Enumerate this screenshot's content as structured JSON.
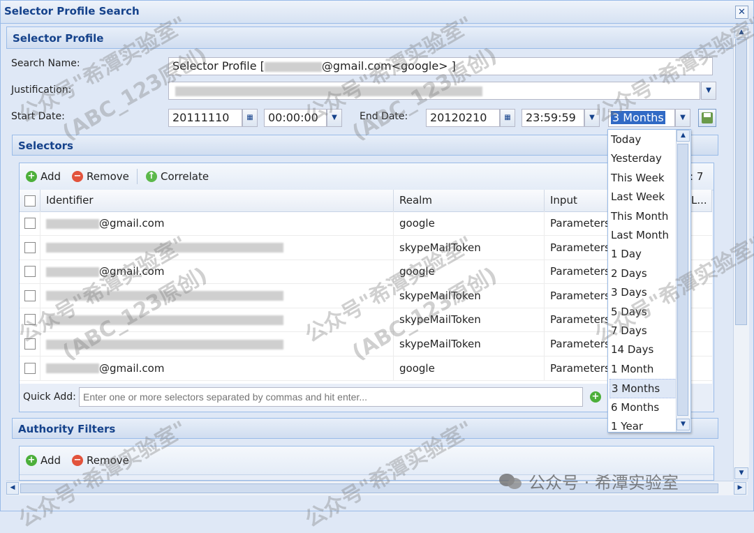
{
  "window": {
    "title": "Selector Profile Search",
    "close_glyph": "✕"
  },
  "profile": {
    "header": "Selector Profile",
    "search_name_label": "Search Name:",
    "search_name_prefix": "Selector Profile [",
    "search_name_suffix": "@gmail.com<google> ]",
    "justification_label": "Justification:",
    "start_date_label": "Start Date:",
    "start_date": "20111110",
    "start_time": "00:00:00",
    "end_date_label": "End Date:",
    "end_date": "20120210",
    "end_time": "23:59:59",
    "range": "3 Months"
  },
  "selectors": {
    "header": "Selectors",
    "toolbar": {
      "add": "Add",
      "remove": "Remove",
      "correlate": "Correlate",
      "count": ": 7"
    },
    "columns": {
      "identifier": "Identifier",
      "realm": "Realm",
      "input": "Input",
      "last": "L..."
    },
    "rows": [
      {
        "identifier": "@gmail.com",
        "realm": "google",
        "input": "Parameters"
      },
      {
        "identifier": "",
        "realm": "skypeMailToken",
        "input": "Parameters"
      },
      {
        "identifier": "@gmail.com",
        "realm": "google",
        "input": "Parameters"
      },
      {
        "identifier": "",
        "realm": "skypeMailToken",
        "input": "Parameters"
      },
      {
        "identifier": "",
        "realm": "skypeMailToken",
        "input": "Parameters"
      },
      {
        "identifier": "",
        "realm": "skypeMailToken",
        "input": "Parameters"
      },
      {
        "identifier": "@gmail.com",
        "realm": "google",
        "input": "Parameters"
      }
    ],
    "quick_add_label": "Quick Add:",
    "quick_add_placeholder": "Enter one or more selectors separated by commas and hit enter..."
  },
  "authority": {
    "header": "Authority Filters",
    "toolbar": {
      "add": "Add",
      "remove": "Remove"
    }
  },
  "range_options": [
    "Today",
    "Yesterday",
    "This Week",
    "Last Week",
    "This Month",
    "Last Month",
    "1 Day",
    "2 Days",
    "3 Days",
    "5 Days",
    "7 Days",
    "14 Days",
    "1 Month",
    "3 Months",
    "6 Months",
    "1 Year"
  ],
  "selected_range": "3 Months",
  "watermarks": {
    "text_a": "公众号\"希潭实验室\"",
    "text_b": "(ABC_123原创)",
    "footer": "公众号 · 希潭实验室"
  },
  "colors": {
    "header_text": "#15428b",
    "panel_bg": "#dfe8f6",
    "border": "#99bbe8",
    "add": "#4caf3a",
    "remove": "#e2533c"
  }
}
